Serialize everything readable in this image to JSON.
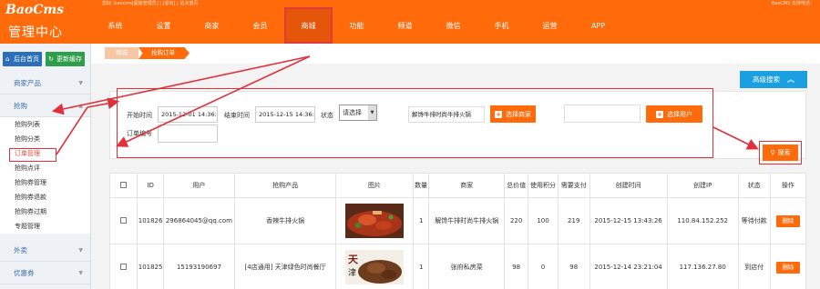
{
  "brand": {
    "logo": "BaoCms",
    "title": "管理中心"
  },
  "topbar": {
    "info_left": "您好: baocms[超级管理员] | [退出] | 站点首页",
    "info_right": "BaoCMS 支持电话："
  },
  "nav": [
    "系统",
    "设置",
    "商家",
    "会员",
    "商城",
    "功能",
    "频道",
    "微信",
    "手机",
    "运营",
    "APP"
  ],
  "quick": {
    "home": "后台首页",
    "cache": "更新缓存"
  },
  "sidebar": {
    "sections": [
      {
        "label": "商家产品",
        "arrow": "▼"
      },
      {
        "label": "抢购",
        "arrow": "▲",
        "items": [
          "抢购列表",
          "抢购分类",
          "订单管理",
          "抢购点评",
          "抢购券管理",
          "抢购券退款",
          "抢购券过期",
          "专题管理"
        ],
        "active": 2
      },
      {
        "label": "外卖",
        "arrow": "▼"
      },
      {
        "label": "优惠券",
        "arrow": "▼"
      }
    ]
  },
  "breadcrumb": [
    "商城",
    "抢购订单"
  ],
  "advanced_search": "高级搜索",
  "filters": {
    "start_label": "开始时间",
    "start_value": "2015-12-01 14:36:40",
    "end_label": "结束时间",
    "end_value": "2015-12-15 14:36:48",
    "status_label": "状态",
    "status_value": "请选择",
    "shop_value": "解馋牛排时尚牛排火锅",
    "choose_shop": "选择商家",
    "user_value": "",
    "choose_user": "选择用户",
    "order_label": "订单编号",
    "order_value": ""
  },
  "search_button": "搜索",
  "table": {
    "headers": [
      "",
      "ID",
      "用户",
      "抢购产品",
      "图片",
      "数量",
      "商家",
      "总价值",
      "使用积分",
      "需要支付",
      "创建时间",
      "创建IP",
      "状态",
      "操作"
    ],
    "rows": [
      {
        "id": "101826",
        "user": "296864045@qq.com",
        "product": "香辣牛排火锅",
        "qty": "1",
        "shop": "解馋牛排时尚牛排火锅",
        "total": "220",
        "points": "100",
        "pay": "219",
        "time": "2015-12-15 13:43:26",
        "ip": "110.84.152.252",
        "status": "等待付款",
        "action": "删除"
      },
      {
        "id": "101825",
        "user": "15193190697",
        "product": "[4店通用] 天津绿色时尚餐厅",
        "qty": "1",
        "shop": "张府私房菜",
        "total": "98",
        "points": "0",
        "pay": "98",
        "time": "2015-12-14 23:21:04",
        "ip": "117.136.27.80",
        "status": "到店付",
        "action": "删除"
      }
    ]
  },
  "colors": {
    "brand_orange": "#ff6a0a",
    "accent_blue": "#1aa0e0",
    "annotation_red": "#e0303a",
    "green": "#2e9e4b"
  }
}
